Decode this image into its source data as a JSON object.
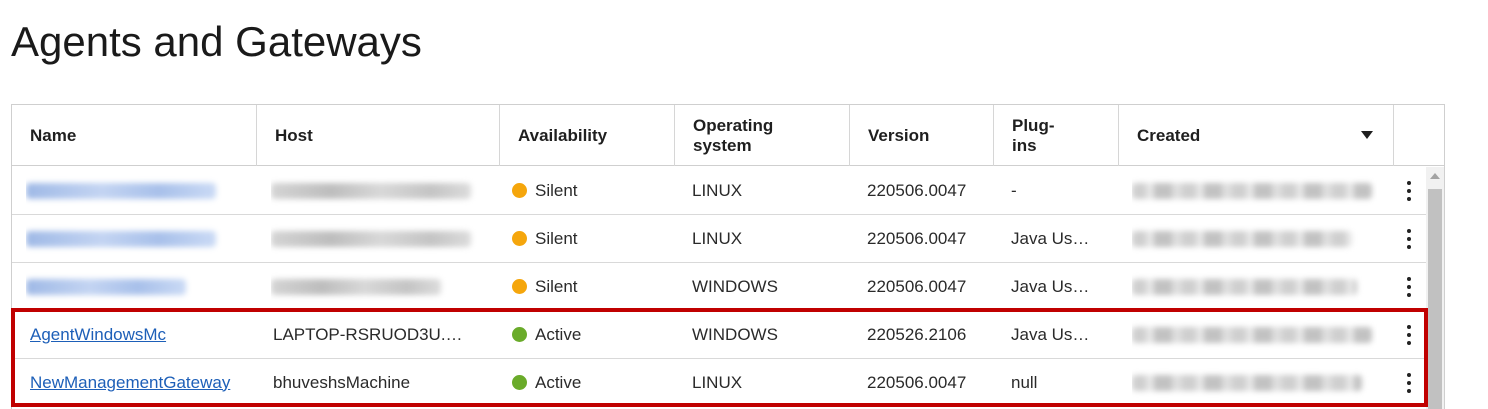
{
  "page": {
    "title": "Agents and Gateways"
  },
  "table": {
    "columns": [
      "Name",
      "Host",
      "Availability",
      "Operating system",
      "Version",
      "Plug-ins",
      "Created"
    ],
    "header": {
      "name": "Name",
      "host": "Host",
      "availability": "Availability",
      "os_line1": "Operating",
      "os_line2": "system",
      "version": "Version",
      "plugins_line1": "Plug-",
      "plugins_line2": "ins",
      "created": "Created",
      "sort_icon": "caret-down-icon"
    },
    "rows": [
      {
        "name": "",
        "host": "",
        "availability": "Silent",
        "os": "LINUX",
        "version": "220506.0047",
        "plugins": "-",
        "created": ""
      },
      {
        "name": "",
        "host": "",
        "availability": "Silent",
        "os": "LINUX",
        "version": "220506.0047",
        "plugins": "Java Us…",
        "created": ""
      },
      {
        "name": "",
        "host": "",
        "availability": "Silent",
        "os": "WINDOWS",
        "version": "220506.0047",
        "plugins": "Java Us…",
        "created": ""
      },
      {
        "name": "AgentWindowsMc",
        "host": "LAPTOP-RSRUOD3U.…",
        "availability": "Active",
        "os": "WINDOWS",
        "version": "220526.2106",
        "plugins": "Java Us…",
        "created": ""
      },
      {
        "name": "NewManagementGateway",
        "host": "bhuveshsMachine",
        "availability": "Active",
        "os": "LINUX",
        "version": "220506.0047",
        "plugins": "null",
        "created": ""
      }
    ]
  },
  "colors": {
    "silent": "#f5a60c",
    "active": "#6aab2a",
    "link": "#1d5fb8",
    "highlight": "#c00000"
  }
}
